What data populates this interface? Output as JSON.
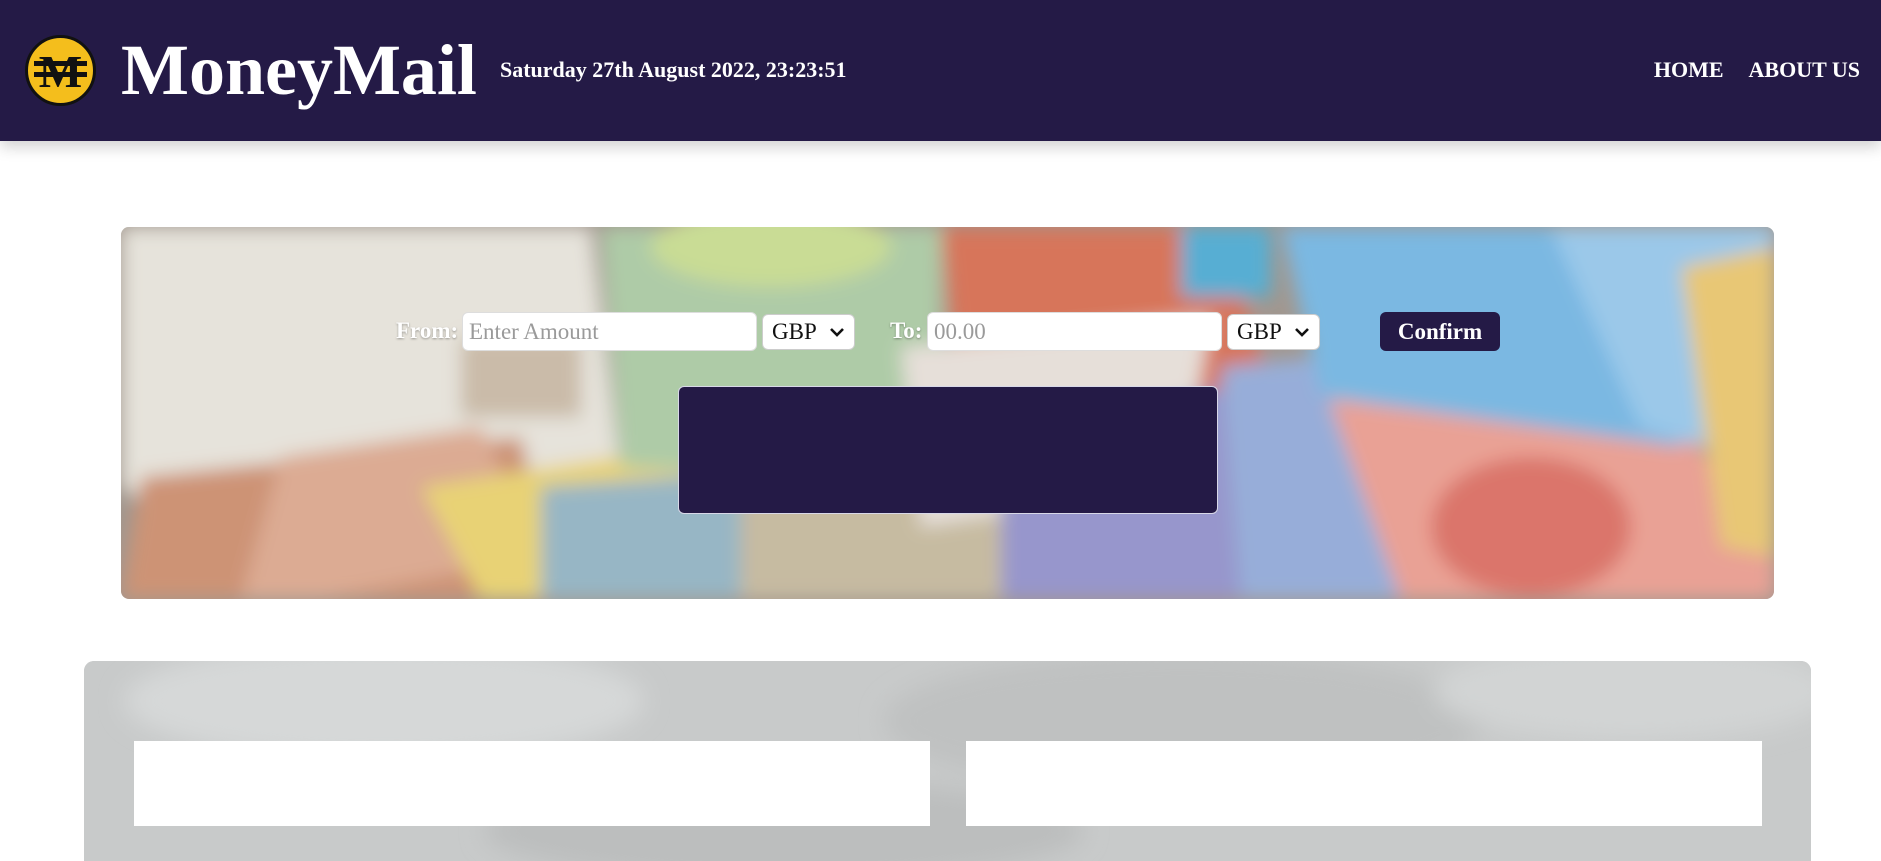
{
  "header": {
    "logo_icon": "moneymail-coin-logo",
    "brand": "MoneyMail",
    "datetime": "Saturday 27th August 2022, 23:23:51",
    "nav": [
      {
        "label": "HOME"
      },
      {
        "label": "ABOUT US"
      }
    ],
    "bg_color": "#241a46",
    "logo_color": "#f4be1c"
  },
  "converter": {
    "from_label": "From:",
    "from_placeholder": "Enter Amount",
    "from_value": "",
    "from_currency": "GBP",
    "to_label": "To:",
    "to_placeholder": "00.00",
    "to_value": "",
    "to_currency": "GBP",
    "confirm_label": "Confirm",
    "result_text": "",
    "background": "blurred-banknotes-image"
  },
  "lower_panel": {
    "background": "grey-texture",
    "cards": [
      {
        "text": ""
      },
      {
        "text": ""
      }
    ]
  }
}
